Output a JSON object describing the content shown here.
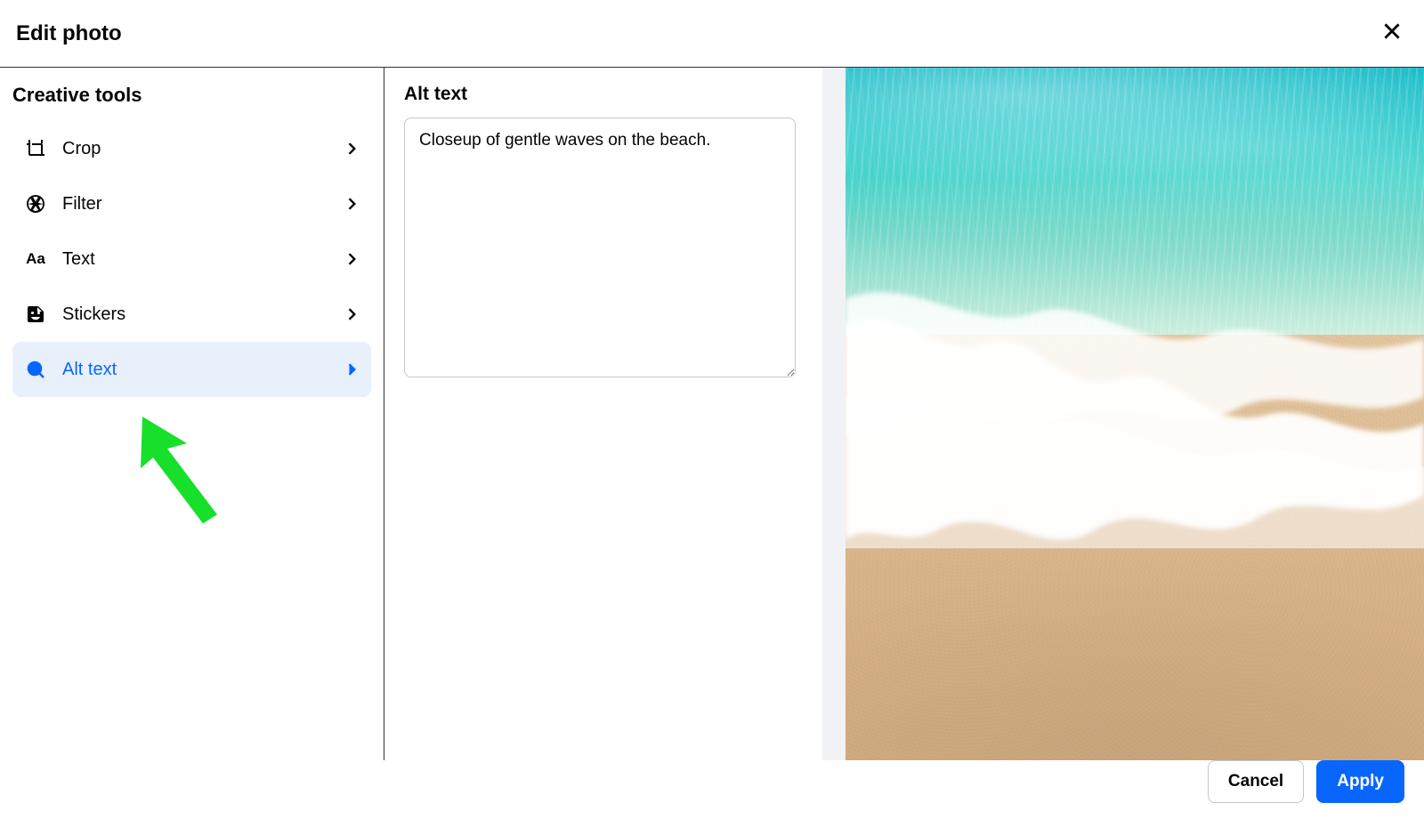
{
  "header": {
    "title": "Edit photo"
  },
  "sidebar": {
    "title": "Creative tools",
    "items": [
      {
        "label": "Crop",
        "icon": "crop-icon",
        "active": false
      },
      {
        "label": "Filter",
        "icon": "filter-icon",
        "active": false
      },
      {
        "label": "Text",
        "icon": "text-icon",
        "active": false
      },
      {
        "label": "Stickers",
        "icon": "sticker-icon",
        "active": false
      },
      {
        "label": "Alt text",
        "icon": "search-icon",
        "active": true
      }
    ]
  },
  "panel": {
    "title": "Alt text",
    "alt_value": "Closeup of gentle waves on the beach."
  },
  "preview": {
    "description": "beach-waves-photo"
  },
  "footer": {
    "cancel": "Cancel",
    "apply": "Apply"
  },
  "annotation": {
    "type": "arrow",
    "color": "#16E02A",
    "target": "sidebar-item-alt-text"
  }
}
